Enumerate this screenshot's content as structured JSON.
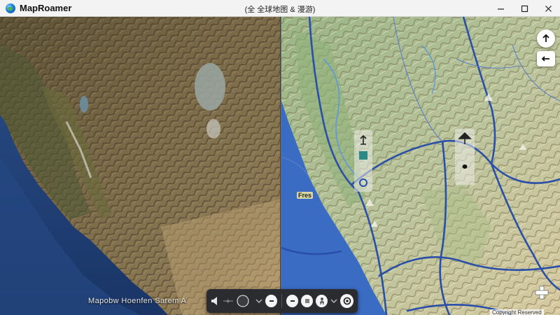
{
  "app": {
    "name": "MapRoamer",
    "window_title": "(全 全球地图 & 漫游)"
  },
  "left_pane": {
    "caption": "Mapobw Hoenfen Sarem A"
  },
  "right_pane": {
    "city_label": "Fres",
    "attribution": "Copyright  Reserved"
  },
  "icons": {
    "app_logo": "globe-icon",
    "minimize": "minimize-icon",
    "maximize": "maximize-icon",
    "close": "close-icon",
    "north": "arrow-up-icon",
    "back": "arrow-left-icon",
    "add": "plus-icon",
    "speaker": "speaker-icon",
    "zoom_out": "minus-icon",
    "layers": "layers-icon",
    "person": "person-icon",
    "locate": "locate-icon"
  },
  "colors": {
    "toolbar_bg": "#2a2c2f",
    "road": "#2a4fa8",
    "ocean_left": "#1d3f78",
    "ocean_right": "#2c5fb8"
  }
}
